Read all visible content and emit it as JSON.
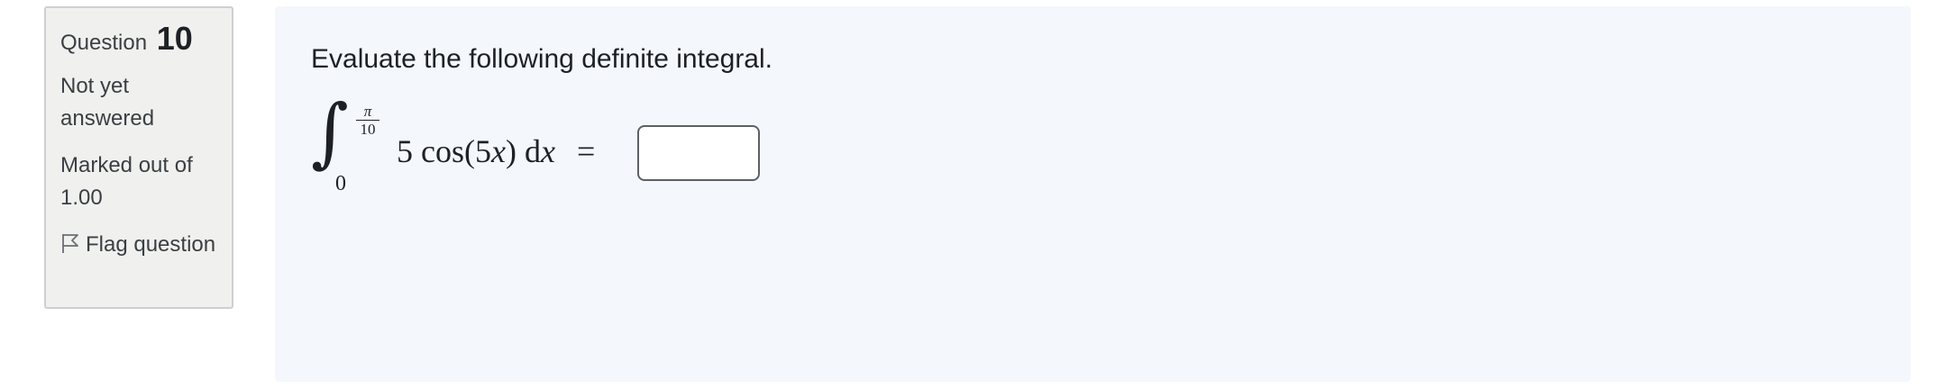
{
  "question_info": {
    "label": "Question",
    "number": "10",
    "state": "Not yet answered",
    "grade": "Marked out of 1.00",
    "flag_label": "Flag question"
  },
  "question": {
    "text": "Evaluate the following definite integral.",
    "formula": {
      "integral_symbol": "∫",
      "upper_numerator": "π",
      "upper_denominator": "10",
      "lower_limit": "0",
      "coefficient": "5",
      "function": "cos(5",
      "variable": "x",
      "close": ")",
      "differential_d": "d",
      "differential_var": "x",
      "equals": "="
    },
    "answer": {
      "value": "",
      "placeholder": ""
    }
  },
  "colors": {
    "info_background": "#f0f0ee",
    "content_background": "#f4f7fc",
    "text": "#1d2125"
  }
}
